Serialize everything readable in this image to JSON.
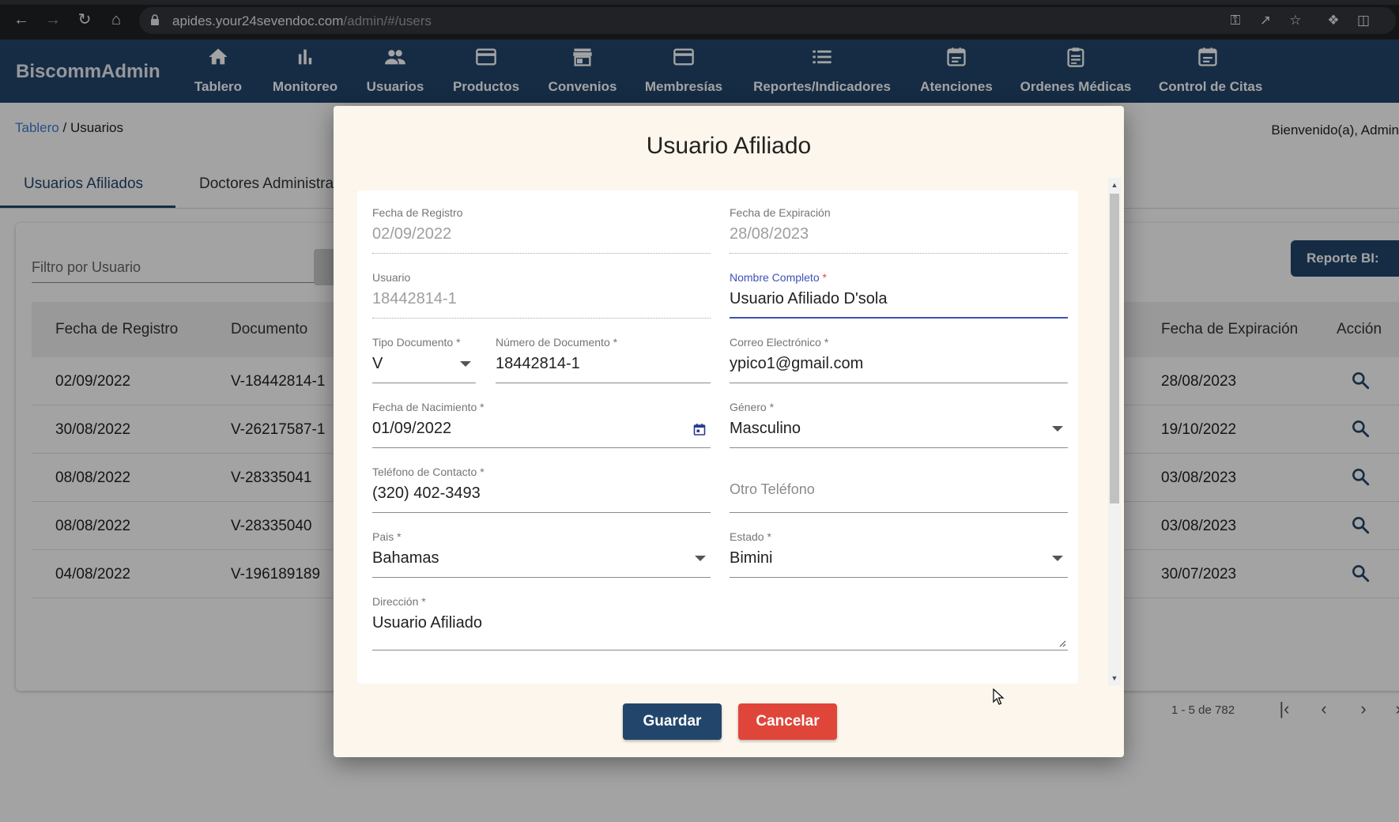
{
  "browser": {
    "url_host": "apides.your24sevendoc.com",
    "url_path": "/admin/#/users"
  },
  "app": {
    "brand": "BiscommAdmin",
    "nav": [
      {
        "label": "Tablero",
        "icon": "home-icon"
      },
      {
        "label": "Monitoreo",
        "icon": "bar-chart-icon"
      },
      {
        "label": "Usuarios",
        "icon": "people-icon"
      },
      {
        "label": "Productos",
        "icon": "card-icon"
      },
      {
        "label": "Convenios",
        "icon": "store-icon"
      },
      {
        "label": "Membresías",
        "icon": "card-icon"
      },
      {
        "label": "Reportes/Indicadores",
        "icon": "list-icon"
      },
      {
        "label": "Atenciones",
        "icon": "calendar-icon"
      },
      {
        "label": "Ordenes Médicas",
        "icon": "clipboard-icon"
      },
      {
        "label": "Control de Citas",
        "icon": "calendar-icon"
      }
    ]
  },
  "page": {
    "breadcrumb_link": "Tablero",
    "breadcrumb_sep": " / ",
    "breadcrumb_current": "Usuarios",
    "welcome": "Bienvenido(a), Admin",
    "tabs": [
      "Usuarios Afiliados",
      "Doctores Administradores"
    ],
    "filter_placeholder": "Filtro por Usuario",
    "report_button": "Reporte BI:",
    "table": {
      "headers": [
        "Fecha de Registro",
        "Documento",
        "Fecha de Expiración",
        "Acción"
      ],
      "rows": [
        {
          "registro": "02/09/2022",
          "documento": "V-18442814-1",
          "expiracion": "28/08/2023"
        },
        {
          "registro": "30/08/2022",
          "documento": "V-26217587-1",
          "expiracion": "19/10/2022"
        },
        {
          "registro": "08/08/2022",
          "documento": "V-28335041",
          "expiracion": "03/08/2023"
        },
        {
          "registro": "08/08/2022",
          "documento": "V-28335040",
          "expiracion": "03/08/2023"
        },
        {
          "registro": "04/08/2022",
          "documento": "V-196189189",
          "expiracion": "30/07/2023"
        }
      ]
    },
    "pager_range": "1 - 5 de 782"
  },
  "modal": {
    "title": "Usuario Afiliado",
    "fields": {
      "fecha_registro": {
        "label": "Fecha de Registro",
        "value": "02/09/2022"
      },
      "fecha_expiracion": {
        "label": "Fecha de Expiración",
        "value": "28/08/2023"
      },
      "usuario": {
        "label": "Usuario",
        "value": "18442814-1"
      },
      "nombre": {
        "label": "Nombre Completo",
        "value": "Usuario Afiliado D'sola"
      },
      "tipo_doc": {
        "label": "Tipo Documento",
        "value": "V"
      },
      "num_doc": {
        "label": "Número de Documento",
        "value": "18442814-1"
      },
      "correo": {
        "label": "Correo Electrónico",
        "value": "ypico1@gmail.com"
      },
      "fecha_nac": {
        "label": "Fecha de Nacimiento",
        "value": "01/09/2022"
      },
      "genero": {
        "label": "Género",
        "value": "Masculino"
      },
      "telefono": {
        "label": "Teléfono de Contacto",
        "value": "(320) 402-3493"
      },
      "otro_tel": {
        "placeholder": "Otro Teléfono"
      },
      "pais": {
        "label": "Pais",
        "value": "Bahamas"
      },
      "estado": {
        "label": "Estado",
        "value": "Bimini"
      },
      "direccion": {
        "label": "Dirección",
        "value": "Usuario Afiliado"
      }
    },
    "required_mark": " *",
    "save": "Guardar",
    "cancel": "Cancelar"
  },
  "colors": {
    "appbar": "#22466b",
    "modal_bg": "#fcf6ec",
    "focus": "#3f51b5",
    "cancel": "#e0453a"
  }
}
